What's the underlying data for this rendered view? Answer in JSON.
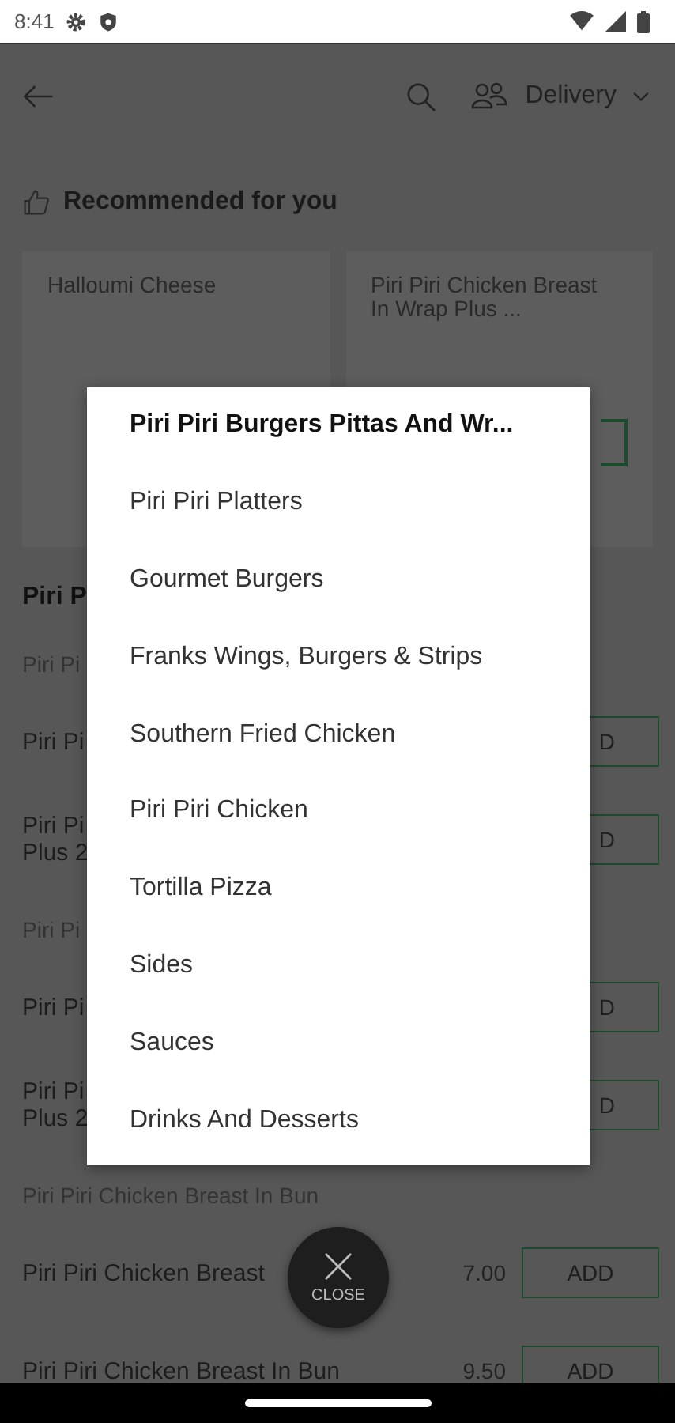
{
  "status_bar": {
    "time": "8:41"
  },
  "header": {
    "mode": "Delivery"
  },
  "recommended": {
    "title": "Recommended for you",
    "cards": [
      {
        "name": "Halloumi Cheese"
      },
      {
        "name": "Piri Piri Chicken Breast In Wrap Plus ...",
        "button_edge": true
      }
    ]
  },
  "menu_rows": [
    {
      "kind": "section",
      "name": "Piri P"
    },
    {
      "kind": "subsection",
      "name": "Piri Pi"
    },
    {
      "kind": "item",
      "name": "Piri Pi",
      "button": "D"
    },
    {
      "kind": "item2",
      "name": "Piri Pi\nPlus 2",
      "button": "D"
    },
    {
      "kind": "subsection",
      "name": "Piri Pi"
    },
    {
      "kind": "item",
      "name": "Piri Pi",
      "button": "D"
    },
    {
      "kind": "item2",
      "name": "Piri Pi\nPlus 2",
      "button": "D"
    },
    {
      "kind": "subsection",
      "name": "Piri Piri Chicken Breast In Bun"
    },
    {
      "kind": "item",
      "name": "Piri Piri Chicken Breast",
      "price": "7.00",
      "button": "ADD"
    },
    {
      "kind": "item2",
      "name": "Piri Piri Chicken Breast In Bun",
      "price": "9.50",
      "button": "ADD"
    }
  ],
  "category_menu": [
    {
      "label": "Piri Piri Burgers Pittas And Wr...",
      "selected": true
    },
    {
      "label": "Piri Piri Platters",
      "selected": false
    },
    {
      "label": "Gourmet Burgers",
      "selected": false
    },
    {
      "label": "Franks Wings, Burgers & Strips",
      "selected": false
    },
    {
      "label": "Southern Fried Chicken",
      "selected": false
    },
    {
      "label": "Piri Piri Chicken",
      "selected": false
    },
    {
      "label": "Tortilla Pizza",
      "selected": false
    },
    {
      "label": "Sides",
      "selected": false
    },
    {
      "label": "Sauces",
      "selected": false
    },
    {
      "label": "Drinks And Desserts",
      "selected": false
    }
  ],
  "close_button": {
    "label": "CLOSE"
  }
}
